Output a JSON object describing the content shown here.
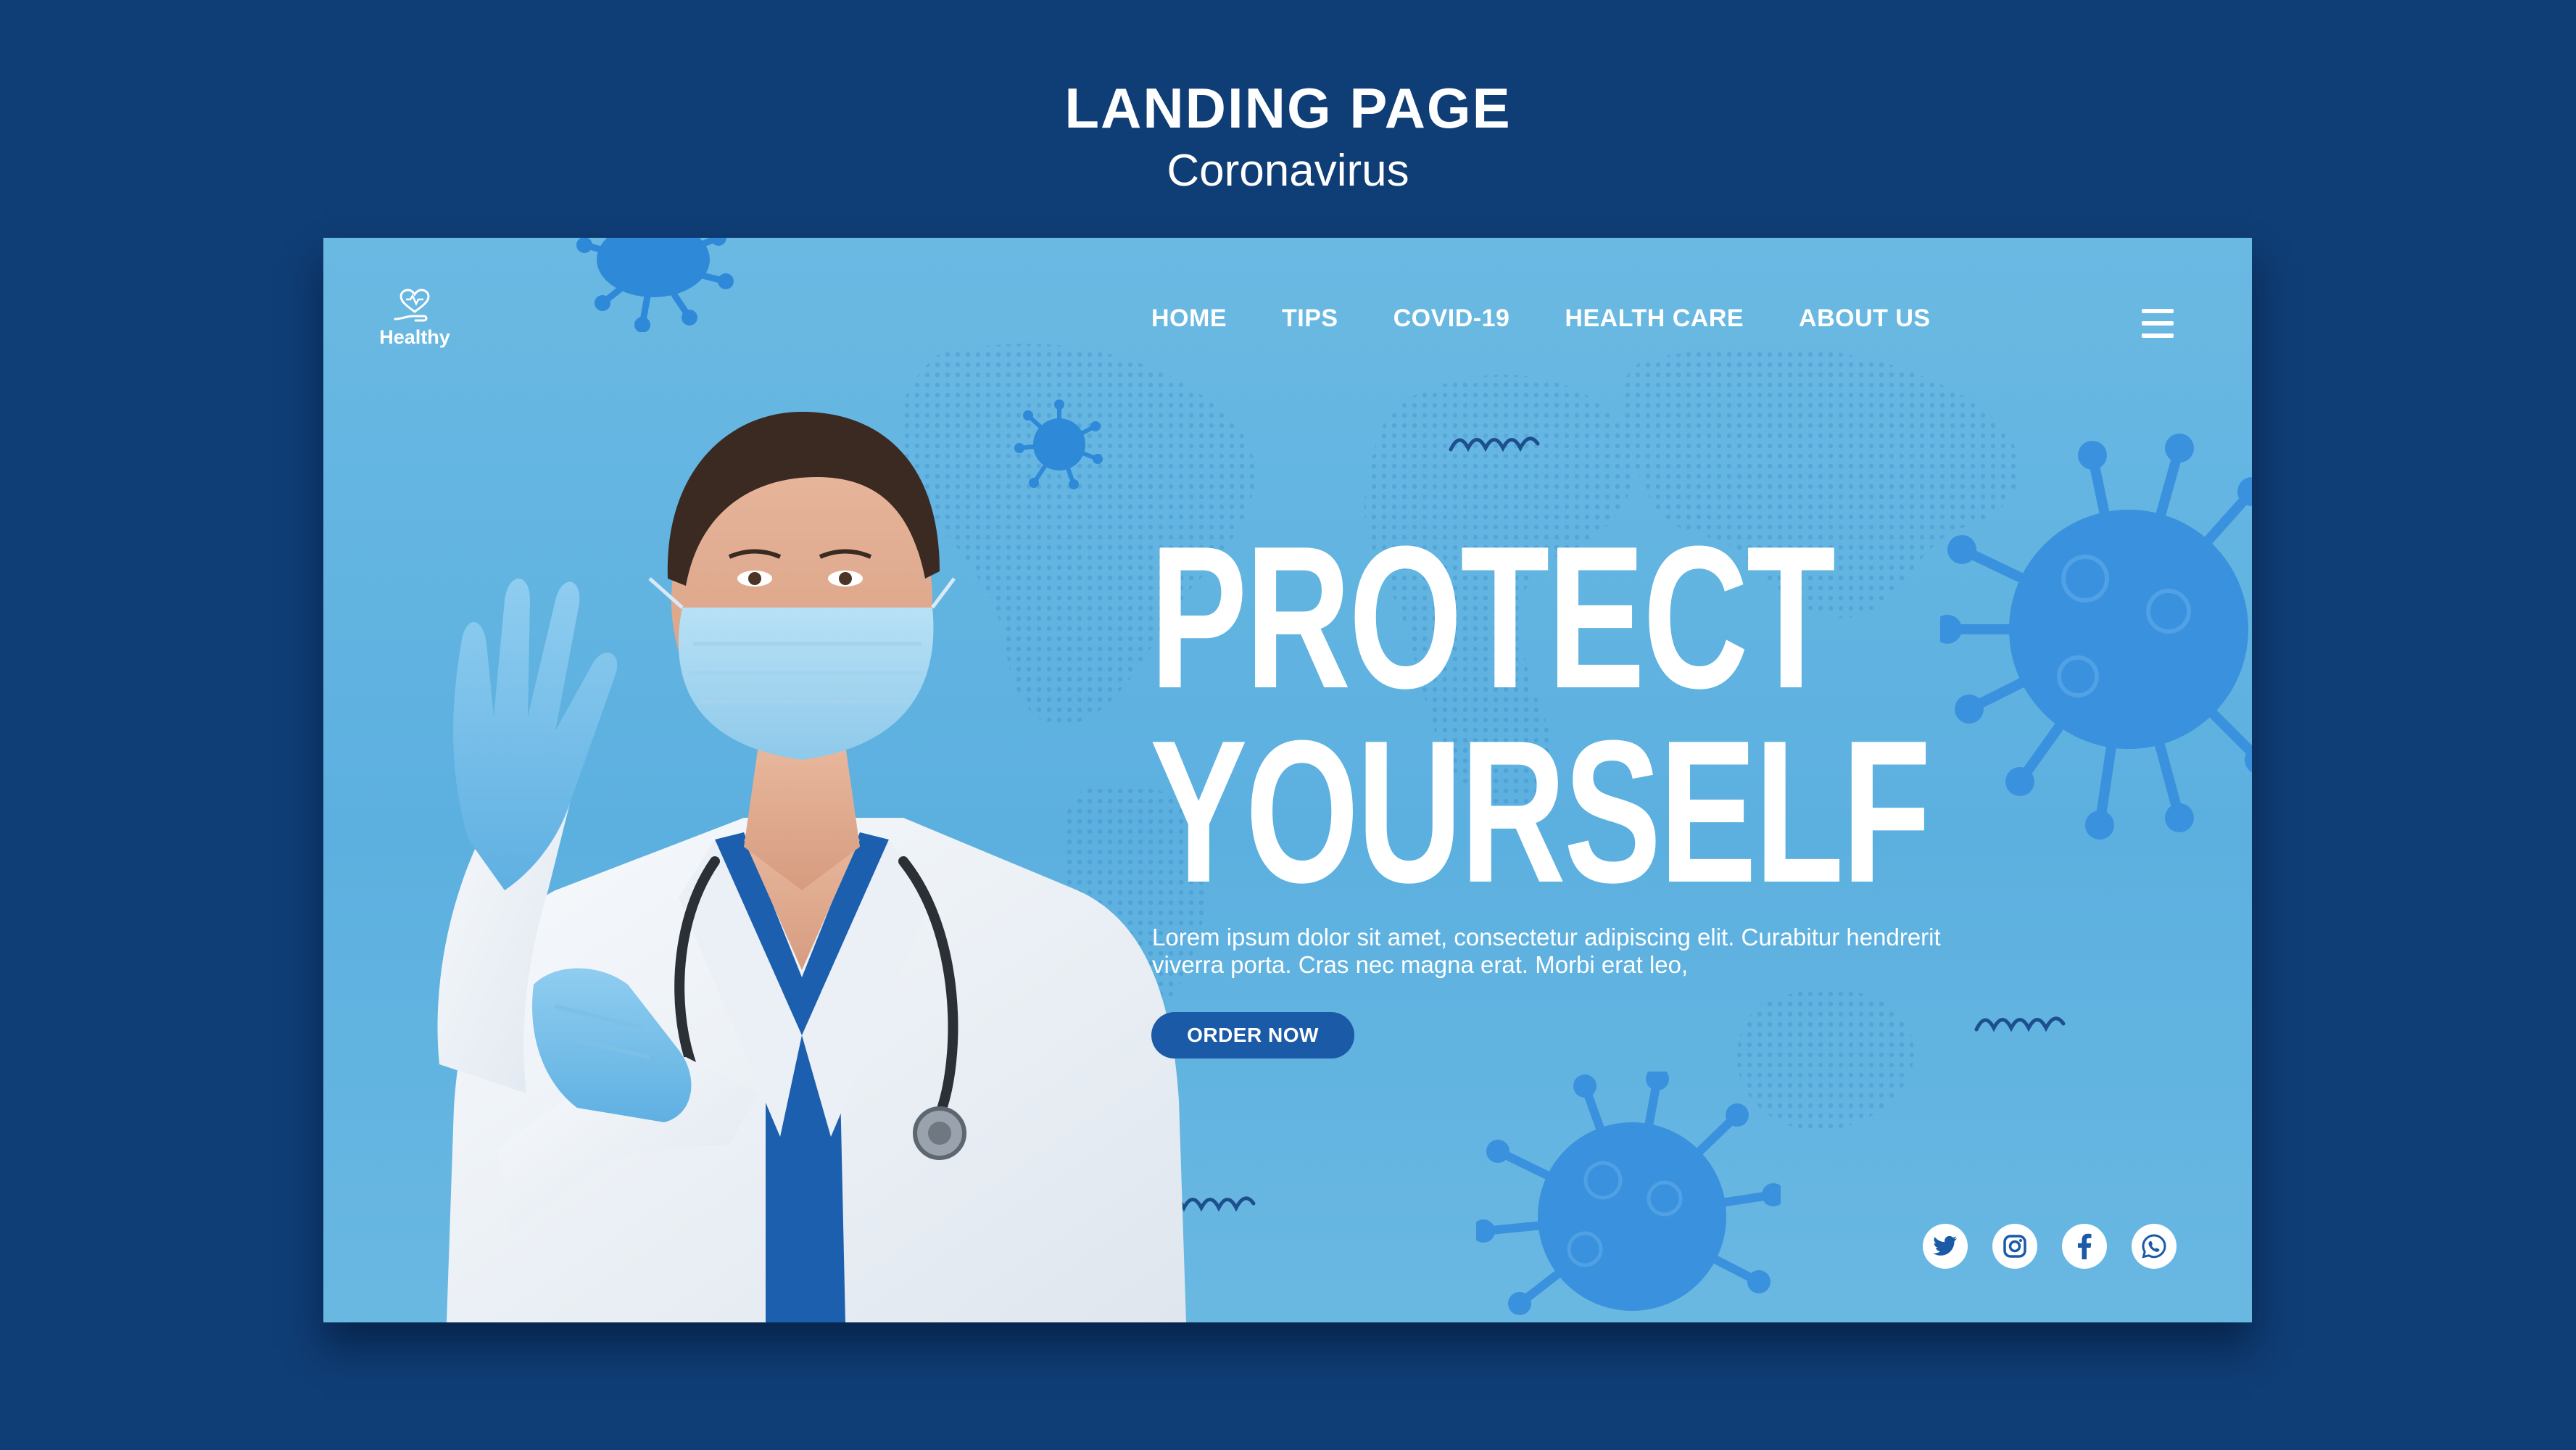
{
  "header": {
    "title": "LANDING PAGE",
    "subtitle": "Coronavirus"
  },
  "logo": {
    "text": "Healthy",
    "icon": "heart-hand-icon"
  },
  "nav": {
    "items": [
      "HOME",
      "TIPS",
      "COVID-19",
      "HEALTH CARE",
      "ABOUT US"
    ],
    "menu_icon": "hamburger-menu-icon"
  },
  "hero": {
    "title_line1": "PROTECT",
    "title_line2": "YOURSELF",
    "body": "Lorem ipsum dolor sit amet, consectetur adipiscing elit. Curabitur hendrerit viverra porta. Cras nec magna erat. Morbi erat leo,",
    "cta_label": "ORDER NOW",
    "image": "doctor-wearing-mask-and-gloves"
  },
  "social": {
    "icons": [
      "twitter-icon",
      "instagram-icon",
      "facebook-icon",
      "whatsapp-icon"
    ]
  },
  "colors": {
    "page_background": "#0f3d75",
    "mockup_background": "#62b4e1",
    "cta_button": "#1a5aa6",
    "virus": "#2e8ad8",
    "text": "#ffffff"
  }
}
